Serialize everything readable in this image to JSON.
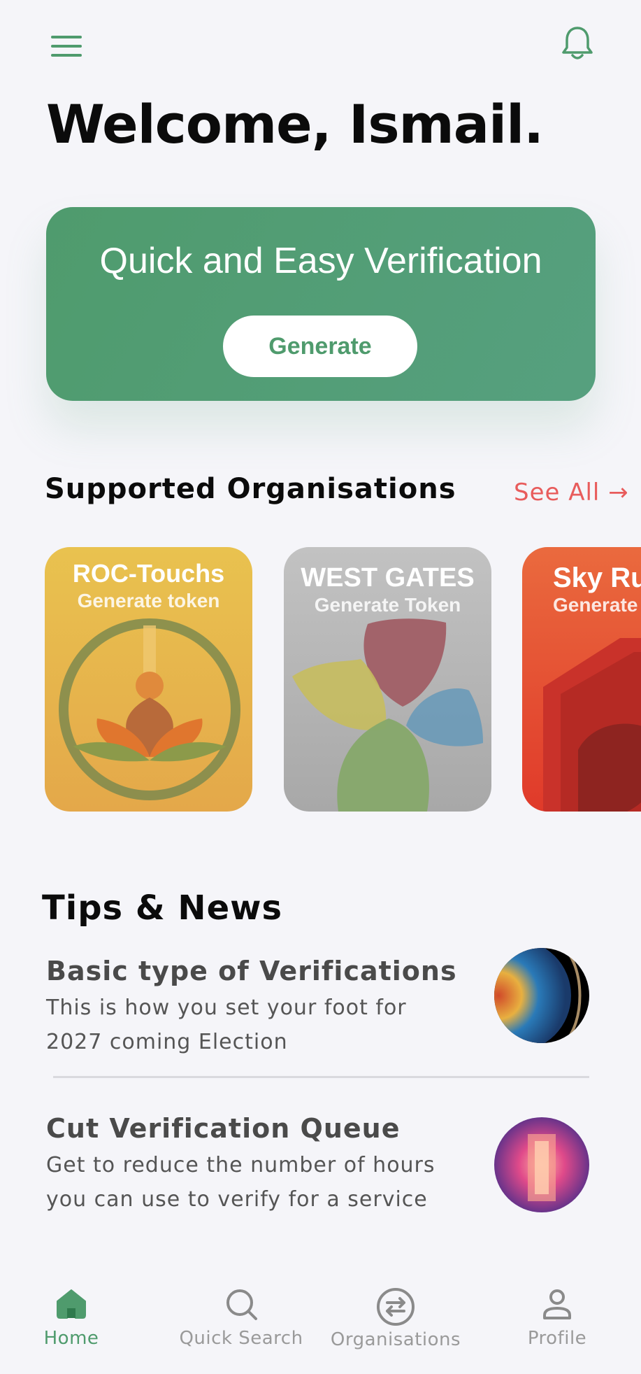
{
  "header": {
    "welcome_text": "Welcome, Ismail."
  },
  "hero": {
    "title": "Quick and Easy Verification",
    "button_label": "Generate"
  },
  "organisations": {
    "section_title": "Supported Organisations",
    "see_all_label": "See All →",
    "items": [
      {
        "name": "ROC-Touchs",
        "subtitle": "Generate token",
        "color": "#e8b84a"
      },
      {
        "name": "WEST GATES",
        "subtitle": "Generate Token",
        "color": "#b8b8b8"
      },
      {
        "name": "Sky Ru",
        "subtitle": "Generate",
        "color": "#e0402e"
      }
    ]
  },
  "tips": {
    "section_title": "Tips & News",
    "items": [
      {
        "title": "Basic type of Verifications",
        "description_line1": "This is how you set your foot for",
        "description_line2": "2027 coming Election"
      },
      {
        "title": "Cut Verification Queue",
        "description_line1": "Get to reduce the number of hours",
        "description_line2": "you can use to verify for a service"
      }
    ]
  },
  "bottom_nav": {
    "items": [
      {
        "label": "Home",
        "icon": "home-icon",
        "active": true
      },
      {
        "label": "Quick Search",
        "icon": "search-icon",
        "active": false
      },
      {
        "label": "Organisations",
        "icon": "swap-icon",
        "active": false
      },
      {
        "label": "Profile",
        "icon": "person-icon",
        "active": false
      }
    ]
  },
  "colors": {
    "brand_green": "#4f9b6d",
    "accent_red": "#e85c5c",
    "background": "#f5f5f9"
  }
}
